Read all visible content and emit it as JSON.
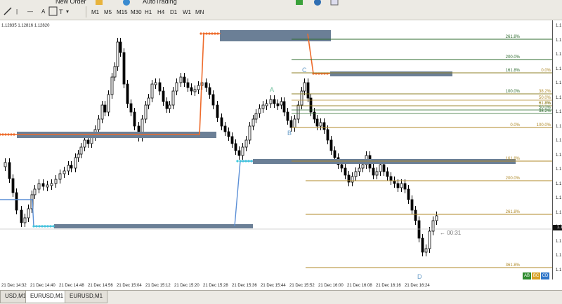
{
  "toolbar": {
    "new_order_label": "New Order",
    "autotrading_label": "AutoTrading",
    "timeframes": [
      "M1",
      "M5",
      "M15",
      "M30",
      "H1",
      "H4",
      "D1",
      "W1",
      "MN"
    ]
  },
  "chart": {
    "price_strip": "1.12835 1.12816 1.12820",
    "countdown": "← 00:31",
    "abcd": {
      "a": "A",
      "b": "B",
      "c": "C",
      "d": "D"
    },
    "fib_labels_right": [
      "261.8%",
      "200.0%",
      "161.8%",
      "100.0%",
      "0.0%",
      "161.8%",
      "200.0%",
      "261.8%",
      "361.8%"
    ],
    "fib_labels_small": [
      "0.0%",
      "38.2%",
      "50.0%",
      "61.8%",
      "61.8%",
      "50.0%",
      "38.2%",
      "100.0%"
    ],
    "price_axis_labels": [
      "1.1",
      "1.1",
      "1.1",
      "1.1",
      "1.1",
      "1.1",
      "1.1",
      "1.1",
      "1.1",
      "1.1",
      "1.1",
      "1.1",
      "1.1",
      "1.1",
      "1.1",
      "1.1",
      "1.1",
      "1.1"
    ],
    "price_marker": "1.1",
    "time_labels": [
      "21 Dec 14:32",
      "21 Dec 14:40",
      "21 Dec 14:48",
      "21 Dec 14:56",
      "21 Dec 15:04",
      "21 Dec 15:12",
      "21 Dec 15:20",
      "21 Dec 15:28",
      "21 Dec 15:36",
      "21 Dec 15:44",
      "21 Dec 15:52",
      "21 Dec 16:00",
      "21 Dec 16:08",
      "21 Dec 16:16",
      "21 Dec 16:24"
    ],
    "badges": [
      "AB",
      "BC",
      "CD"
    ],
    "colors": {
      "candle": "#000000",
      "zone": "#6b7f96",
      "orange": "#ee6b2b",
      "cyan": "#3cc8dc",
      "fib_green": "#2e6b2e",
      "fib_gold": "#b08a2a"
    }
  },
  "tabs": [
    "USD,M1",
    "EURUSD,M1",
    "EURUSD,M1"
  ]
}
